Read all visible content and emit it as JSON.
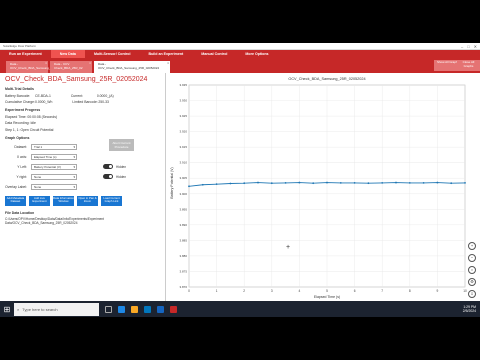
{
  "window": {
    "title": "SolarEdge Flow Platform"
  },
  "menu": [
    "Run an Experiment",
    "New Data",
    "Multi-Sensor/ Control",
    "Build an Experiment",
    "Manual Control",
    "More Options"
  ],
  "tabs": [
    {
      "label": "Data - OCV_Check_BDA_Samsung_25R"
    },
    {
      "label": "Data - CCV Check_BDA_25R_02"
    },
    {
      "label": "Data - OCV_Check_BDA_Samsung_25R_02052024",
      "active": true
    }
  ],
  "right_buttons": [
    "Show All Graphs",
    "Close All Graphs"
  ],
  "experiment": {
    "title": "OCV_Check_BDA_Samsung_25R_02052024",
    "section_test": "Multi-Trial Details",
    "rows": [
      [
        "Battery Barcode:",
        "CE-BDA-1",
        "Current:",
        "0.0000_(A)"
      ],
      [
        "Cumulative Charge:",
        "0.0000_Wh",
        "Limited Barcode:",
        "250-33"
      ]
    ],
    "section_progress": "Experiment Progress",
    "progress": [
      "Elapsed Time: 00:00:08 (Seconds)",
      "Data Recording: Idle",
      "Step 1, 1: Open Circuit Potential"
    ],
    "progress_button": "Abort Current Procedure"
  },
  "graph_options": {
    "title": "Graph Options",
    "rows": [
      {
        "label": "Dataset:",
        "value": "Trial 1",
        "toggle": false
      },
      {
        "label": "X axis:",
        "value": "Elapsed Time (s)",
        "toggle": false
      },
      {
        "label": "Y Left:",
        "value": "Battery Potential (V)",
        "toggle": true,
        "toggle_label": "Hidden"
      },
      {
        "label": "Y right:",
        "value": "None",
        "toggle": true,
        "toggle_label": "Hidden"
      },
      {
        "label": "Overlay Label:",
        "value": "None",
        "toggle": true,
        "toggle_label": "Hidden"
      }
    ],
    "buttons": [
      "Add Metadata Dataset",
      "Add Live Experiment",
      "Data Information Window",
      "Open in Pan & Zoom",
      "Load Current Graph Link"
    ]
  },
  "data_location": {
    "title": "File Data Location",
    "path": "C:/Users/OPV/Home/Desktop/Data/Data/Info/Experiments/Experiment Data/OCV_Check_BDA_Samsung_25R_02052024"
  },
  "chart_data": {
    "type": "line",
    "title": "OCV_Check_BDA_Samsung_25R_02052024",
    "xlabel": "Elapsed Time (s)",
    "ylabel": "Battery Potential (V)",
    "xlim": [
      0,
      10
    ],
    "ylim": [
      3.87,
      3.935
    ],
    "xticks": [
      0,
      1,
      2,
      3,
      4,
      5,
      6,
      7,
      8,
      9,
      10
    ],
    "yticks": [
      "3.870",
      "3.875",
      "3.880",
      "3.885",
      "3.890",
      "3.895",
      "3.900",
      "3.905",
      "3.910",
      "3.915",
      "3.920",
      "3.925",
      "3.930",
      "3.935"
    ],
    "x": [
      0,
      0.5,
      1,
      1.5,
      2,
      2.5,
      3,
      3.5,
      4,
      4.5,
      5,
      5.5,
      6,
      6.5,
      7,
      7.5,
      8,
      8.5,
      9,
      9.5,
      10
    ],
    "values": [
      3.9024,
      3.9029,
      3.9031,
      3.9033,
      3.9034,
      3.9036,
      3.9034,
      3.9035,
      3.9036,
      3.9034,
      3.9036,
      3.9035,
      3.9035,
      3.9034,
      3.9035,
      3.9036,
      3.9035,
      3.9035,
      3.9036,
      3.9034,
      3.9035
    ],
    "line_color": "#1f77b4"
  },
  "side_tools": [
    "zoom-in-icon",
    "zoom-out-icon",
    "reset-icon",
    "settings-icon",
    "export-icon"
  ],
  "taskbar": {
    "search_placeholder": "Type here to search",
    "time": "1:29 PM",
    "date": "2/5/2024"
  },
  "colors": {
    "accent": "#c62828",
    "button": "#1976d2"
  }
}
